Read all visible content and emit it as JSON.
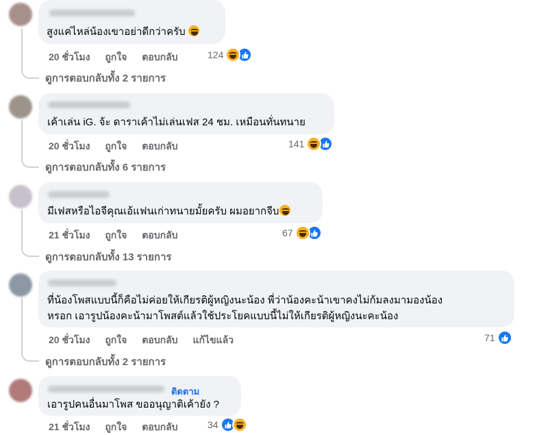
{
  "comments": [
    {
      "text": "สูงแค่ไหล่น้องเขาอย่าดีกว่าครับ",
      "time": "20 ชั่วโมง",
      "like_label": "ถูกใจ",
      "reply_label": "ตอบกลับ",
      "reaction_count": "124",
      "reactions": [
        "haha-icon",
        "like-icon"
      ],
      "replies_text": "ดูการตอบกลับทั้ง 2 รายการ",
      "avatar_color": "#a8908a"
    },
    {
      "text": "เค้าเล่น iG. จ้ะ ดาราเค้าไม่เล่นเฟส 24 ชม. เหมือนทั่นทนาย",
      "time": "20 ชั่วโมง",
      "like_label": "ถูกใจ",
      "reply_label": "ตอบกลับ",
      "reaction_count": "141",
      "reactions": [
        "haha-icon",
        "like-icon"
      ],
      "replies_text": "ดูการตอบกลับทั้ง 6 รายการ",
      "avatar_color": "#9c948a"
    },
    {
      "text": "มีเฟสหรือไอจีคุณเอ้แฟนเก่าทนายมั้ยครับ ผมอยากจีบ",
      "time": "21 ชั่วโมง",
      "like_label": "ถูกใจ",
      "reply_label": "ตอบกลับ",
      "reaction_count": "67",
      "reactions": [
        "haha-icon",
        "like-icon"
      ],
      "replies_text": "ดูการตอบกลับทั้ง 13 รายการ",
      "avatar_color": "#c8c0cc"
    },
    {
      "text_line1": "ที่น้องโพสแบบนี้ก็คือไม่ค่อยให้เกียรติผู้หญิงนะน้อง พี่ว่าน้องคะน้าเขาคงไม่ก้มลงมามองน้อง",
      "text_line2": "หรอก เอารูปน้องคะน้ามาโพสต์แล้วใช้ประโยคแบบนี้ไม่ให้เกียรติผู้หญิงนะคะน้อง",
      "time": "20 ชั่วโมง",
      "like_label": "ถูกใจ",
      "reply_label": "ตอบกลับ",
      "edited_label": "แก้ไขแล้ว",
      "reaction_count": "71",
      "reactions": [
        "like-icon"
      ],
      "replies_text": "ดูการตอบกลับทั้ง 2 รายการ",
      "avatar_color": "#8c98a4"
    },
    {
      "follow_label": "ติดตาม",
      "text": "เอารูปคนอื่นมาโพส ขออนุญาติเค้ายัง ?",
      "time": "21 ชั่วโมง",
      "like_label": "ถูกใจ",
      "reply_label": "ตอบกลับ",
      "reaction_count": "34",
      "reactions": [
        "like-icon",
        "haha-icon"
      ],
      "avatar_color": "#b07a7a"
    }
  ]
}
